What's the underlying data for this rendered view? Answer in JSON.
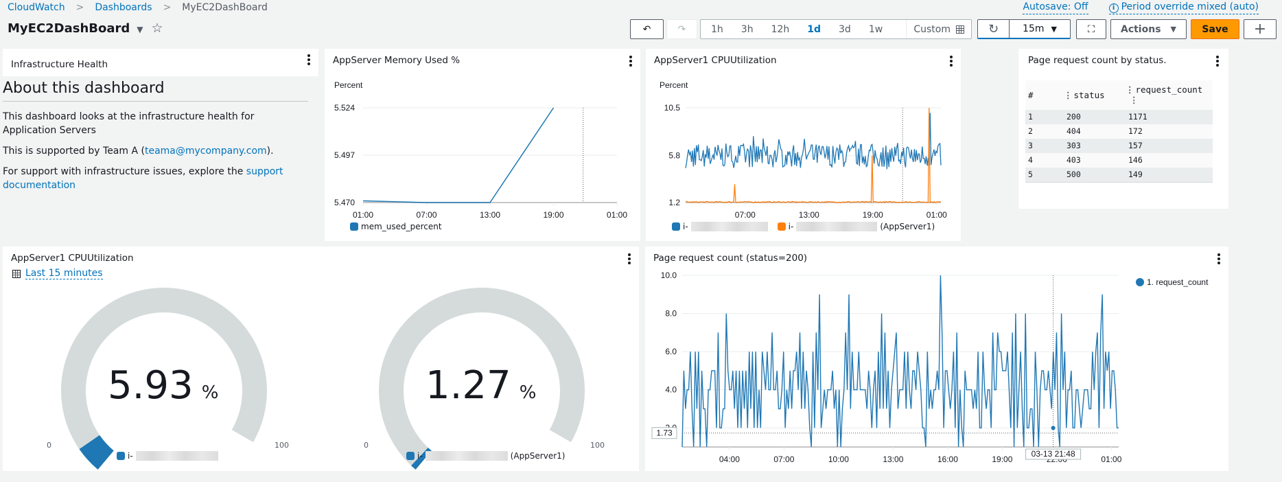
{
  "breadcrumb": [
    {
      "label": "CloudWatch",
      "link": true
    },
    {
      "label": "Dashboards",
      "link": true
    },
    {
      "label": "MyEC2DashBoard",
      "link": false
    }
  ],
  "header": {
    "title": "MyEC2DashBoard",
    "autosave": "Autosave: Off",
    "period_override": "Period override mixed (auto)"
  },
  "toolbar": {
    "undo_icon": "↶",
    "redo_icon": "↷",
    "time_ranges": [
      "1h",
      "3h",
      "12h",
      "1d",
      "3d",
      "1w"
    ],
    "active_range": "1d",
    "custom_label": "Custom",
    "refresh_icon": "↻",
    "refresh_interval": "15m",
    "fullscreen_icon": "⛶",
    "actions_label": "Actions",
    "save_label": "Save",
    "add_label": "+"
  },
  "widgets": {
    "text": {
      "title": "Infrastructure Health",
      "heading": "About this dashboard",
      "p1": "This dashboard looks at the infrastructure health for Application Servers",
      "p2_prefix": "This is supported by Team A (",
      "p2_link": "teama@mycompany.com",
      "p2_suffix": ").",
      "p3_prefix": "For support with infrastructure issues, explore the ",
      "p3_link": "support documentation"
    },
    "memory": {
      "title": "AppServer Memory Used %"
    },
    "cpu": {
      "title": "AppServer1 CPUUtilization"
    },
    "table": {
      "title": "Page request count by status.",
      "columns": [
        "#",
        "status",
        "request_count"
      ],
      "rows": [
        [
          "1",
          "200",
          "1171"
        ],
        [
          "2",
          "404",
          "172"
        ],
        [
          "3",
          "303",
          "157"
        ],
        [
          "4",
          "403",
          "146"
        ],
        [
          "5",
          "500",
          "149"
        ]
      ]
    },
    "gauges": {
      "title": "AppServer1 CPUUtilization",
      "time_link": "Last 15 minutes",
      "min_label": "0",
      "max_label": "100",
      "items": [
        {
          "value": "5.93",
          "unit": "%",
          "fraction": 0.0593,
          "legend_prefix": "i-",
          "legend_suffix": ""
        },
        {
          "value": "1.27",
          "unit": "%",
          "fraction": 0.0127,
          "legend_prefix": "i-",
          "legend_suffix": "(AppServer1)"
        }
      ]
    },
    "requests": {
      "title": "Page request count (status=200)"
    }
  },
  "colors": {
    "blue": "#1f77b4",
    "orange": "#ff7f0e",
    "gauge_track": "#d5dbdb",
    "save": "#ff9900",
    "link": "#0073bb"
  },
  "chart_data": [
    {
      "id": "memory",
      "type": "line",
      "title": "AppServer Memory Used %",
      "ylabel": "Percent",
      "ylim": [
        5.47,
        5.524
      ],
      "yticks": [
        "5.524",
        "5.497",
        "5.470"
      ],
      "xticks": [
        "01:00",
        "07:00",
        "13:00",
        "19:00",
        "01:00"
      ],
      "x_hours": [
        0,
        6,
        12,
        18,
        24
      ],
      "series": [
        {
          "name": "mem_used_percent",
          "color": "#1f77b4",
          "x": [
            0,
            6,
            12,
            18
          ],
          "y": [
            5.471,
            5.47,
            5.47,
            5.524
          ]
        }
      ],
      "cursor_hour": 20.8
    },
    {
      "id": "cpu",
      "type": "line",
      "title": "AppServer1 CPUUtilization",
      "ylabel": "Percent",
      "ylim": [
        1.2,
        10.5
      ],
      "yticks": [
        "10.5",
        "5.8",
        "1.2"
      ],
      "xticks": [
        "07:00",
        "13:00",
        "19:00",
        "01:00"
      ],
      "x_hours": [
        6,
        12,
        18,
        24
      ],
      "xrange_hours": [
        0.4,
        24.4
      ],
      "cursor_hour": 20.8,
      "series": [
        {
          "name": "i-(redacted)",
          "legend_suffix": "",
          "color": "#1f77b4",
          "baseline": 5.8,
          "amplitude": 1.2,
          "spike_hour": 23.4,
          "spike_value": 10.0
        },
        {
          "name": "i-(redacted)",
          "legend_suffix": "(AppServer1)",
          "color": "#ff7f0e",
          "baseline": 1.25,
          "spikes": [
            {
              "hour": 5.0,
              "value": 3.0
            },
            {
              "hour": 17.9,
              "value": 5.8
            },
            {
              "hour": 23.3,
              "value": 10.5
            }
          ]
        }
      ]
    },
    {
      "id": "requests",
      "type": "line",
      "title": "Page request count (status=200)",
      "ylim": [
        1.0,
        10.0
      ],
      "yticks": [
        "10.0",
        "8.0",
        "6.0",
        "4.0",
        "2.0"
      ],
      "ytick_values": [
        10,
        8,
        6,
        4,
        2
      ],
      "xticks": [
        "04:00",
        "07:00",
        "10:00",
        "13:00",
        "16:00",
        "19:00",
        "22:00",
        "01:00"
      ],
      "x_hours": [
        3,
        6,
        9,
        12,
        15,
        18,
        21,
        24
      ],
      "xrange_hours": [
        0.4,
        24.4
      ],
      "legend": "1. request_count",
      "legend_position": "top-right",
      "threshold_label": "1.73",
      "threshold_value": 1.73,
      "cursor_label": "03-13 21:48",
      "cursor_hour": 20.8,
      "series": [
        {
          "name": "1. request_count",
          "color": "#1f77b4",
          "y": [
            1,
            5,
            3,
            4,
            4,
            6,
            3,
            1,
            6,
            3,
            6,
            1,
            5,
            3,
            3,
            1,
            4,
            4,
            5,
            5,
            5,
            2,
            7,
            2,
            2,
            3,
            3,
            8,
            5,
            4,
            4,
            5,
            3,
            5,
            2,
            5,
            2,
            5,
            3,
            5,
            2,
            6,
            3,
            6,
            2,
            6,
            2,
            4,
            2,
            6,
            5,
            4,
            6,
            4,
            4,
            7,
            4,
            4,
            5,
            3,
            3,
            4,
            6,
            2,
            4,
            3,
            5,
            3,
            5,
            5,
            6,
            4,
            7,
            3,
            6,
            3,
            5,
            4,
            2,
            1,
            6,
            2,
            7,
            4,
            9,
            2,
            3,
            4,
            3,
            4,
            4,
            4,
            5,
            3,
            4,
            1,
            4,
            1,
            3,
            4,
            7,
            4,
            9,
            3,
            6,
            4,
            4,
            4,
            6,
            4,
            4,
            4,
            4,
            3,
            5,
            4,
            2,
            4,
            5,
            2,
            6,
            3,
            8,
            3,
            7,
            3,
            5,
            2,
            4,
            5,
            6,
            7,
            3,
            4,
            4,
            4,
            6,
            3,
            6,
            4,
            3,
            5,
            5,
            4,
            6,
            5,
            4,
            2,
            2,
            1,
            6,
            3,
            4,
            3,
            4,
            4,
            5,
            4,
            10,
            7,
            2,
            5,
            5,
            4,
            3,
            4,
            6,
            2,
            7,
            1,
            4,
            2,
            1,
            5,
            4,
            4,
            4,
            4,
            3,
            4,
            3,
            6,
            2,
            2,
            6,
            4,
            3,
            4,
            4,
            2,
            7,
            4,
            4,
            7,
            6,
            6,
            5,
            5,
            5,
            6,
            4,
            2,
            7,
            1,
            8,
            2,
            4,
            6,
            3,
            1,
            8,
            2,
            2,
            3,
            3,
            1,
            6,
            4,
            1,
            4,
            5,
            5,
            4,
            4,
            5,
            4,
            3,
            6,
            4,
            7,
            2,
            1,
            8,
            4,
            6,
            2,
            4,
            4,
            5,
            2,
            2,
            4,
            4,
            3,
            2,
            3,
            4,
            4,
            4,
            3,
            3,
            6,
            4,
            6,
            7,
            2,
            7,
            9,
            3,
            6,
            5,
            6,
            3,
            5,
            5,
            4,
            2,
            2
          ]
        }
      ]
    }
  ]
}
